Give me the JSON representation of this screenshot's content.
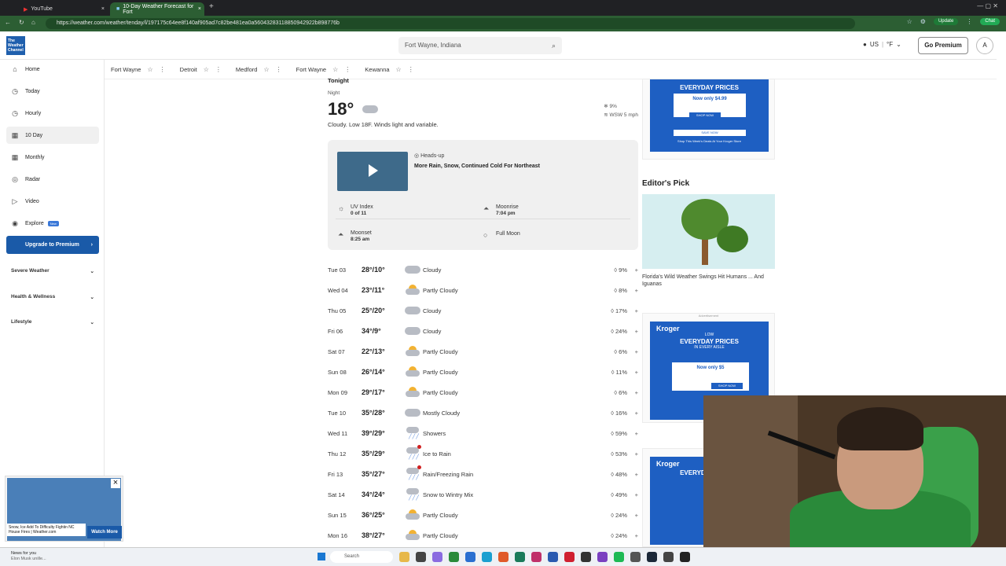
{
  "browser": {
    "tabs": [
      {
        "label": "YouTube",
        "active": false
      },
      {
        "label": "10-Day Weather Forecast for Fort",
        "active": true
      }
    ],
    "url": "https://weather.com/weather/tenday/l/197175c64ee8f140af905ad7c82be481ea0a56043283118850942922b898776b",
    "update_label": "Update",
    "chat_label": "Chat"
  },
  "header": {
    "logo_text": "The Weather Channel",
    "search_value": "Fort Wayne, Indiana",
    "region": "US",
    "unit": "°F",
    "premium_label": "Go Premium",
    "avatar_letter": "A"
  },
  "sidebar": {
    "items": [
      {
        "label": "Home",
        "icon": "house-icon"
      },
      {
        "label": "Today",
        "icon": "clock-icon"
      },
      {
        "label": "Hourly",
        "icon": "clock-icon"
      },
      {
        "label": "10 Day",
        "icon": "calendar-icon"
      },
      {
        "label": "Monthly",
        "icon": "calendar-icon"
      },
      {
        "label": "Radar",
        "icon": "radar-icon"
      },
      {
        "label": "Video",
        "icon": "video-icon"
      },
      {
        "label": "Explore",
        "icon": "explore-icon",
        "badge": "New"
      }
    ],
    "upgrade_label": "Upgrade to Premium",
    "sections": [
      "Severe Weather",
      "Health & Wellness",
      "Lifestyle"
    ]
  },
  "locations": [
    "Fort Wayne",
    "Detroit",
    "Medford",
    "Fort Wayne",
    "Kewanna"
  ],
  "tonight": {
    "title": "Tonight",
    "period": "Night",
    "temp": "18°",
    "precip": "9%",
    "wind": "WSW 5 mph",
    "description": "Cloudy. Low 18F. Winds light and variable."
  },
  "card": {
    "headsup_label": "Heads-up",
    "video_title": "More Rain, Snow, Continued Cold For Northeast",
    "uv_label": "UV Index",
    "uv_value": "0 of 11",
    "moonrise_label": "Moonrise",
    "moonrise_value": "7:04 pm",
    "moonset_label": "Moonset",
    "moonset_value": "8:25 am",
    "moon_phase": "Full Moon"
  },
  "forecast": [
    {
      "day": "Tue 03",
      "temps": "28°/10°",
      "icon": "cloudy",
      "cond": "Cloudy",
      "precip": "9%"
    },
    {
      "day": "Wed 04",
      "temps": "23°/11°",
      "icon": "partly-cloudy",
      "cond": "Partly Cloudy",
      "precip": "8%"
    },
    {
      "day": "Thu 05",
      "temps": "25°/20°",
      "icon": "cloudy",
      "cond": "Cloudy",
      "precip": "17%"
    },
    {
      "day": "Fri 06",
      "temps": "34°/9°",
      "icon": "cloudy",
      "cond": "Cloudy",
      "precip": "24%"
    },
    {
      "day": "Sat 07",
      "temps": "22°/13°",
      "icon": "partly-cloudy",
      "cond": "Partly Cloudy",
      "precip": "6%"
    },
    {
      "day": "Sun 08",
      "temps": "26°/14°",
      "icon": "partly-cloudy",
      "cond": "Partly Cloudy",
      "precip": "11%"
    },
    {
      "day": "Mon 09",
      "temps": "29°/17°",
      "icon": "partly-cloudy",
      "cond": "Partly Cloudy",
      "precip": "6%"
    },
    {
      "day": "Tue 10",
      "temps": "35°/28°",
      "icon": "cloudy",
      "cond": "Mostly Cloudy",
      "precip": "16%"
    },
    {
      "day": "Wed 11",
      "temps": "39°/29°",
      "icon": "rain",
      "cond": "Showers",
      "precip": "59%"
    },
    {
      "day": "Thu 12",
      "temps": "35°/29°",
      "icon": "rain-alert",
      "cond": "Ice to Rain",
      "precip": "53%"
    },
    {
      "day": "Fri 13",
      "temps": "35°/27°",
      "icon": "rain-alert",
      "cond": "Rain/Freezing Rain",
      "precip": "48%"
    },
    {
      "day": "Sat 14",
      "temps": "34°/24°",
      "icon": "rain",
      "cond": "Snow to Wintry Mix",
      "precip": "49%"
    },
    {
      "day": "Sun 15",
      "temps": "36°/25°",
      "icon": "partly-cloudy",
      "cond": "Partly Cloudy",
      "precip": "24%"
    },
    {
      "day": "Mon 16",
      "temps": "38°/27°",
      "icon": "partly-cloudy",
      "cond": "Partly Cloudy",
      "precip": "24%"
    }
  ],
  "ads": {
    "ad1_big": "EVERYDAY PRICES",
    "ad1_price": "Now only $4.99",
    "ad1_shop": "SHOP NOW",
    "ad1_save": "SAVE NOW",
    "ad1_footer": "Shop This Week's Deals At Your Kroger Store",
    "label": "Advertisement",
    "ad2_brand": "Kroger",
    "ad2_low": "LOW",
    "ad2_big": "EVERYDAY PRICES",
    "ad2_sub": "IN EVERY AISLE",
    "ad2_price": "Now only $5",
    "ad2_shop": "SHOP NOW",
    "ad3_brand": "Kroger",
    "ad3_big": "EVERYDAY PRICES"
  },
  "editors_pick": {
    "title": "Editor's Pick",
    "caption": "Florida's Wild Weather Swings Hit Humans ... And Iguanas"
  },
  "mini_player": {
    "caption": "Snow, Ice Add To Difficulty Fightin NC House Fires | Weather.com",
    "watch_label": "Watch More"
  },
  "taskbar": {
    "news_title": "News for you",
    "news_sub": "Elon Musk unille...",
    "search_label": "Search"
  }
}
